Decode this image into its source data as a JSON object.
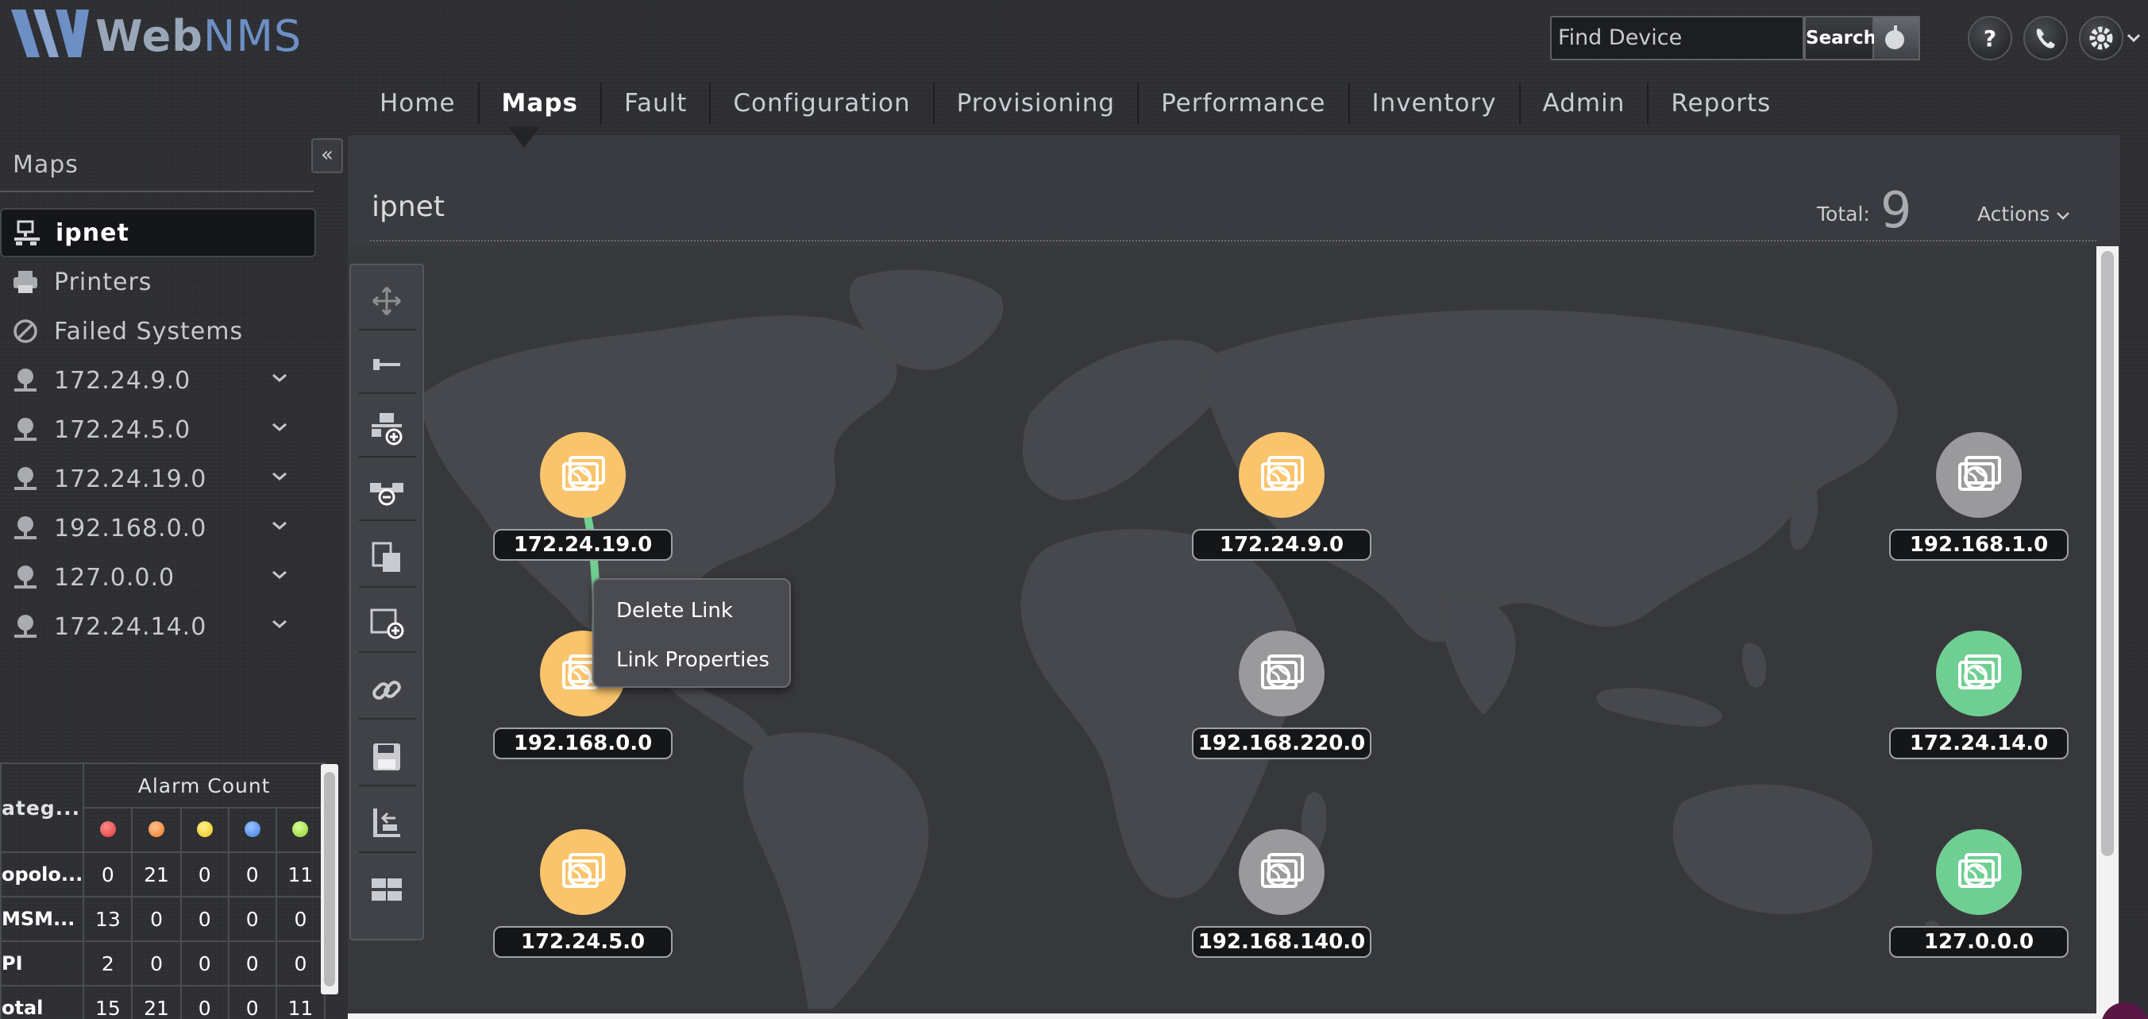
{
  "app": {
    "logo_brand": "Web",
    "logo_suffix": "NMS"
  },
  "search": {
    "placeholder": "Find Device",
    "button_label": "Search"
  },
  "header_icons": [
    "help-icon",
    "phone-icon",
    "settings-icon"
  ],
  "nav": {
    "items": [
      "Home",
      "Maps",
      "Fault",
      "Configuration",
      "Provisioning",
      "Performance",
      "Inventory",
      "Admin",
      "Reports"
    ],
    "active": "Maps"
  },
  "sidebar": {
    "title": "Maps",
    "items": [
      {
        "label": "ipnet",
        "icon": "network-icon",
        "active": true,
        "expandable": false
      },
      {
        "label": "Printers",
        "icon": "printer-icon",
        "active": false,
        "expandable": false
      },
      {
        "label": "Failed Systems",
        "icon": "blocked-icon",
        "active": false,
        "expandable": false
      },
      {
        "label": "172.24.9.0",
        "icon": "network-node-icon",
        "active": false,
        "expandable": true
      },
      {
        "label": "172.24.5.0",
        "icon": "network-node-icon",
        "active": false,
        "expandable": true
      },
      {
        "label": "172.24.19.0",
        "icon": "network-node-icon",
        "active": false,
        "expandable": true
      },
      {
        "label": "192.168.0.0",
        "icon": "network-node-icon",
        "active": false,
        "expandable": true
      },
      {
        "label": "127.0.0.0",
        "icon": "network-node-icon",
        "active": false,
        "expandable": true
      },
      {
        "label": "172.24.14.0",
        "icon": "network-node-icon",
        "active": false,
        "expandable": true
      }
    ]
  },
  "alarm_table": {
    "category_header": "ateg...",
    "count_header": "Alarm Count",
    "severity_colors": [
      "#e23b3b",
      "#f07a2a",
      "#f2c21b",
      "#3d7de0",
      "#8fd12b"
    ],
    "rows": [
      {
        "category": "opolo...",
        "counts": [
          "0",
          "21",
          "0",
          "0",
          "11"
        ]
      },
      {
        "category": "MSM...",
        "counts": [
          "13",
          "0",
          "0",
          "0",
          "0"
        ]
      },
      {
        "category": "PI",
        "counts": [
          "2",
          "0",
          "0",
          "0",
          "0"
        ]
      },
      {
        "category": "otal",
        "counts": [
          "15",
          "21",
          "0",
          "0",
          "11"
        ]
      }
    ]
  },
  "panel": {
    "title": "ipnet",
    "total_label": "Total:",
    "total_value": "9",
    "actions_label": "Actions"
  },
  "toolbar": [
    "move-icon",
    "link-tool-icon",
    "add-node-icon",
    "remove-node-icon",
    "copy-icon",
    "add-map-icon",
    "link-icon",
    "save-icon",
    "layout-icon",
    "grid-icon"
  ],
  "map_nodes": [
    {
      "label": "172.24.19.0",
      "status_color": "#f9c46b"
    },
    {
      "label": "172.24.9.0",
      "status_color": "#f9c46b"
    },
    {
      "label": "192.168.1.0",
      "status_color": "#9a9a9c"
    },
    {
      "label": "192.168.0.0",
      "status_color": "#f9c46b"
    },
    {
      "label": "192.168.220.0",
      "status_color": "#9a9a9c"
    },
    {
      "label": "172.24.14.0",
      "status_color": "#6fcf93"
    },
    {
      "label": "172.24.5.0",
      "status_color": "#f9c46b"
    },
    {
      "label": "192.168.140.0",
      "status_color": "#9a9a9c"
    },
    {
      "label": "127.0.0.0",
      "status_color": "#6fcf93"
    }
  ],
  "context_menu": {
    "items": [
      "Delete Link",
      "Link Properties"
    ]
  },
  "colors": {
    "accent": "#6d8fc4",
    "link_color": "#6fcf93"
  }
}
